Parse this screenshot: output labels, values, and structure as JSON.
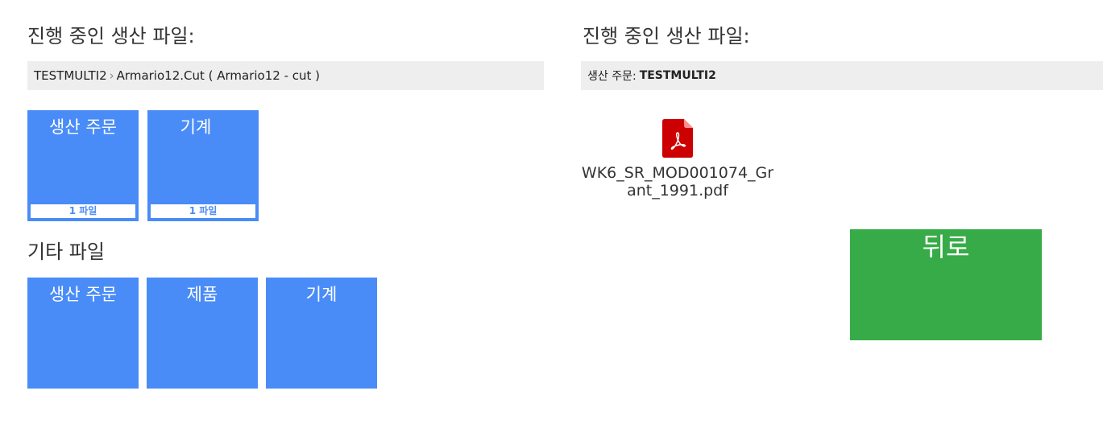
{
  "left_panel": {
    "title": "진행 중인 생산 파일:",
    "breadcrumb": {
      "order": "TESTMULTI2",
      "separator": "›",
      "item": "Armario12.Cut ( Armario12 - cut )"
    },
    "file_tiles": [
      {
        "label": "생산 주문",
        "count": "1 파일"
      },
      {
        "label": "기계",
        "count": "1 파일"
      }
    ],
    "other_title": "기타 파일",
    "other_tiles": [
      {
        "label": "생산 주문"
      },
      {
        "label": "제품"
      },
      {
        "label": "기계"
      }
    ]
  },
  "right_panel": {
    "title": "진행 중인 생산 파일:",
    "order_prefix": "생산 주문:",
    "order_value": "TESTMULTI2",
    "file": {
      "icon": "pdf-file-icon",
      "name": "WK6_SR_MOD001074_Grant_1991.pdf"
    },
    "back_button": "뒤로"
  },
  "colors": {
    "tile_blue": "#4a8cf7",
    "back_green": "#37ab47",
    "bar_grey": "#eeeeee",
    "pdf_red": "#cc0000"
  }
}
